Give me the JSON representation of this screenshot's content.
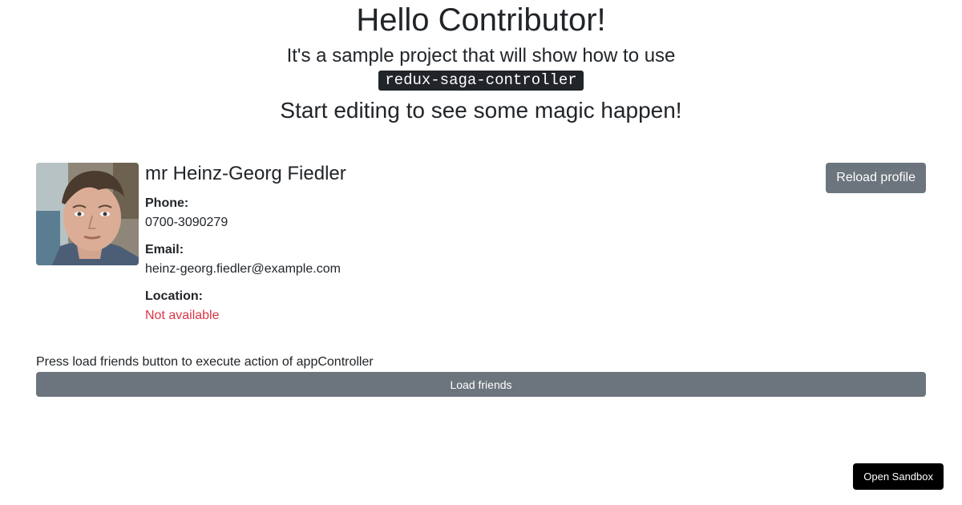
{
  "header": {
    "title": "Hello Contributor!",
    "subtitle": "It's a sample project that will show how to use",
    "code": "redux-saga-controller",
    "tagline": "Start editing to see some magic happen!"
  },
  "profile": {
    "name": "mr Heinz-Georg Fiedler",
    "phone_label": "Phone:",
    "phone": "0700-3090279",
    "email_label": "Email:",
    "email": "heinz-georg.fiedler@example.com",
    "location_label": "Location:",
    "location": "Not available",
    "reload_label": "Reload profile",
    "avatar_alt": "avatar"
  },
  "friends": {
    "hint": "Press load friends button to execute action of appController",
    "load_label": "Load friends"
  },
  "sandbox": {
    "label": "Open Sandbox"
  },
  "colors": {
    "text": "#212529",
    "secondary": "#6c757d",
    "danger": "#dc3545",
    "code_bg": "#212529",
    "sandbox_bg": "#000000"
  }
}
